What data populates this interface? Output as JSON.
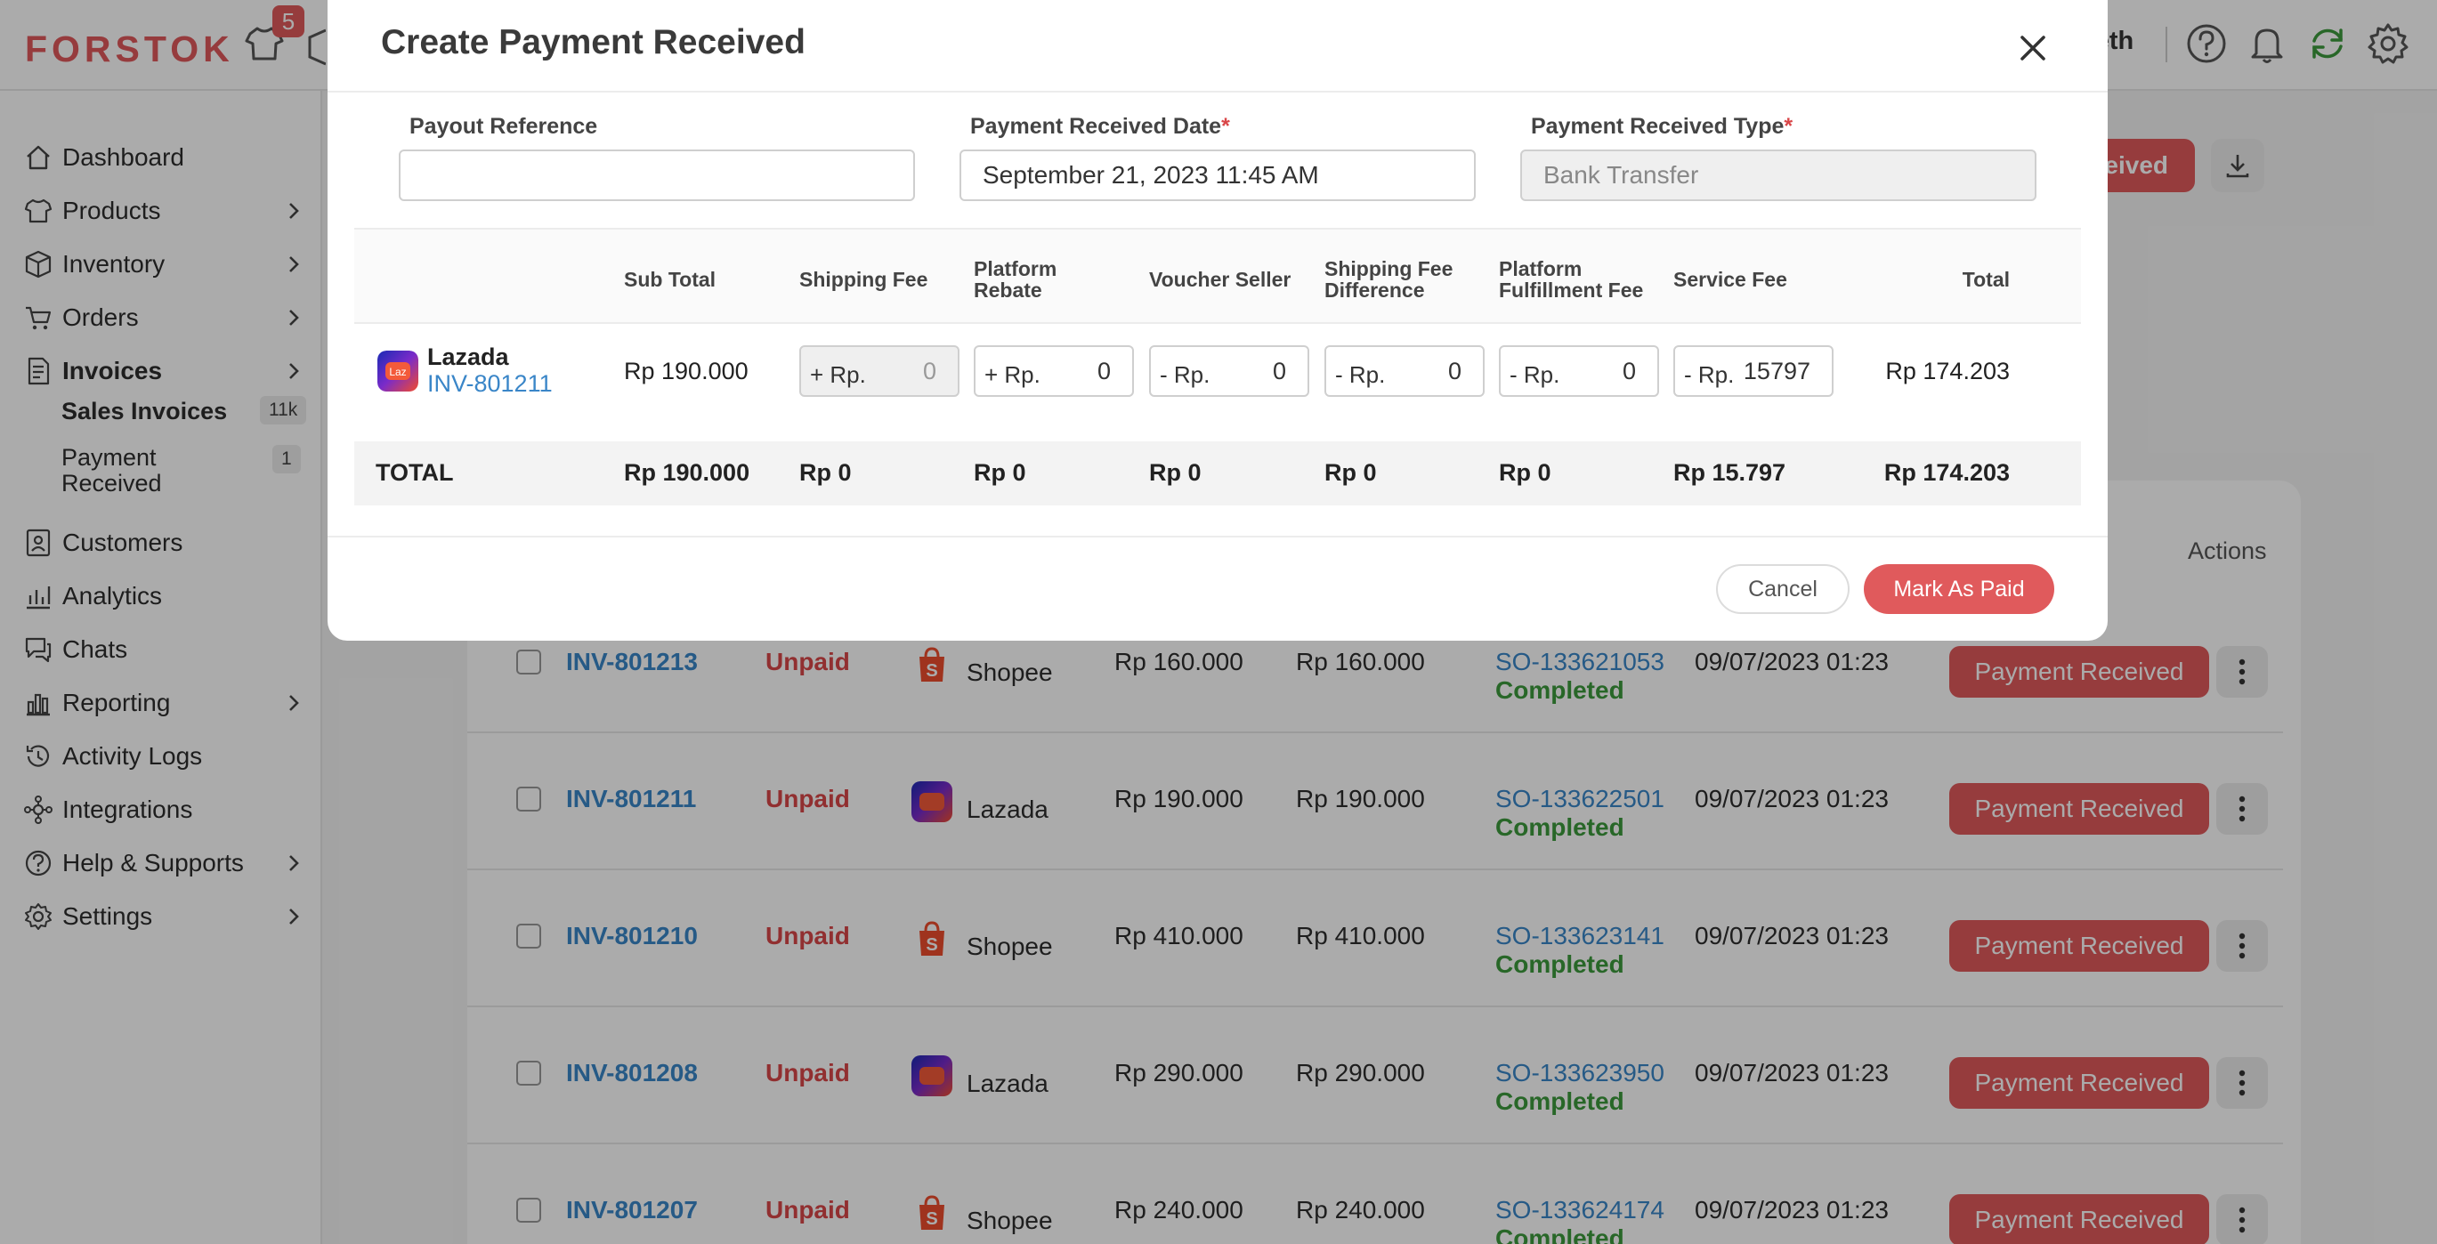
{
  "app": {
    "logo": "FORSTOK",
    "notification_count": "5",
    "user_name": "beth"
  },
  "sidebar": {
    "items": [
      {
        "label": "Dashboard",
        "icon": "home-icon",
        "has_children": false
      },
      {
        "label": "Products",
        "icon": "shirt-icon",
        "has_children": true
      },
      {
        "label": "Inventory",
        "icon": "box-icon",
        "has_children": true
      },
      {
        "label": "Orders",
        "icon": "cart-icon",
        "has_children": true
      },
      {
        "label": "Invoices",
        "icon": "document-icon",
        "has_children": true
      },
      {
        "label": "Customers",
        "icon": "contact-card-icon",
        "has_children": false
      },
      {
        "label": "Analytics",
        "icon": "analytics-icon",
        "has_children": false
      },
      {
        "label": "Chats",
        "icon": "chat-icon",
        "has_children": false
      },
      {
        "label": "Reporting",
        "icon": "bar-chart-icon",
        "has_children": true
      },
      {
        "label": "Activity Logs",
        "icon": "history-icon",
        "has_children": false
      },
      {
        "label": "Integrations",
        "icon": "integrations-icon",
        "has_children": false
      },
      {
        "label": "Help & Supports",
        "icon": "help-icon",
        "has_children": true
      },
      {
        "label": "Settings",
        "icon": "gear-icon",
        "has_children": true
      }
    ],
    "sub_items": [
      {
        "label": "Sales Invoices",
        "count": "11k"
      },
      {
        "label": "Payment Received",
        "count": "1"
      }
    ]
  },
  "background": {
    "top_button_label": "eived",
    "actions_header": "Actions",
    "row_button_label": "Payment Received",
    "rows": [
      {
        "invoice": "INV-801213",
        "status": "Unpaid",
        "marketplace": "Shopee",
        "amount": "Rp 160.000",
        "total": "Rp 160.000",
        "order": "SO-133621053",
        "order_status": "Completed",
        "date": "09/07/2023 01:23"
      },
      {
        "invoice": "INV-801211",
        "status": "Unpaid",
        "marketplace": "Lazada",
        "amount": "Rp 190.000",
        "total": "Rp 190.000",
        "order": "SO-133622501",
        "order_status": "Completed",
        "date": "09/07/2023 01:23"
      },
      {
        "invoice": "INV-801210",
        "status": "Unpaid",
        "marketplace": "Shopee",
        "amount": "Rp 410.000",
        "total": "Rp 410.000",
        "order": "SO-133623141",
        "order_status": "Completed",
        "date": "09/07/2023 01:23"
      },
      {
        "invoice": "INV-801208",
        "status": "Unpaid",
        "marketplace": "Lazada",
        "amount": "Rp 290.000",
        "total": "Rp 290.000",
        "order": "SO-133623950",
        "order_status": "Completed",
        "date": "09/07/2023 01:23"
      },
      {
        "invoice": "INV-801207",
        "status": "Unpaid",
        "marketplace": "Shopee",
        "amount": "Rp 240.000",
        "total": "Rp 240.000",
        "order": "SO-133624174",
        "order_status": "Completed",
        "date": "09/07/2023 01:23"
      }
    ]
  },
  "modal": {
    "title": "Create Payment Received",
    "fields": {
      "payout_reference": {
        "label": "Payout Reference",
        "value": ""
      },
      "payment_date": {
        "label": "Payment Received Date",
        "required_mark": "*",
        "value": "September 21, 2023 11:45 AM"
      },
      "payment_type": {
        "label": "Payment Received Type",
        "required_mark": "*",
        "value": "Bank Transfer"
      }
    },
    "columns": {
      "sub_total": "Sub Total",
      "shipping_fee": "Shipping Fee",
      "platform_rebate_1": "Platform",
      "platform_rebate_2": "Rebate",
      "voucher_seller": "Voucher Seller",
      "shipping_fee_diff_1": "Shipping Fee",
      "shipping_fee_diff_2": "Difference",
      "platform_fulfillment_1": "Platform",
      "platform_fulfillment_2": "Fulfillment Fee",
      "service_fee": "Service Fee",
      "total": "Total"
    },
    "item": {
      "marketplace": "Lazada",
      "marketplace_logo_text": "Laz",
      "invoice": "INV-801211",
      "sub_total": "Rp 190.000",
      "fees": {
        "shipping_fee": {
          "prefix": "+ Rp.",
          "value": "0"
        },
        "platform_rebate": {
          "prefix": "+ Rp.",
          "value": "0"
        },
        "voucher_seller": {
          "prefix": "- Rp.",
          "value": "0"
        },
        "shipping_fee_difference": {
          "prefix": "- Rp.",
          "value": "0"
        },
        "platform_fulfillment_fee": {
          "prefix": "- Rp.",
          "value": "0"
        },
        "service_fee": {
          "prefix": "- Rp.",
          "value": "15797"
        }
      },
      "total": "Rp 174.203"
    },
    "totals": {
      "label": "TOTAL",
      "sub_total": "Rp 190.000",
      "shipping_fee": "Rp 0",
      "platform_rebate": "Rp 0",
      "voucher_seller": "Rp 0",
      "shipping_fee_difference": "Rp 0",
      "platform_fulfillment_fee": "Rp 0",
      "service_fee": "Rp 15.797",
      "total": "Rp 174.203"
    },
    "buttons": {
      "cancel": "Cancel",
      "mark_as_paid": "Mark As Paid"
    }
  },
  "colors": {
    "brand": "#e0595c",
    "link": "#3a86c8",
    "success": "#3d9a3d",
    "danger": "#d94648"
  }
}
